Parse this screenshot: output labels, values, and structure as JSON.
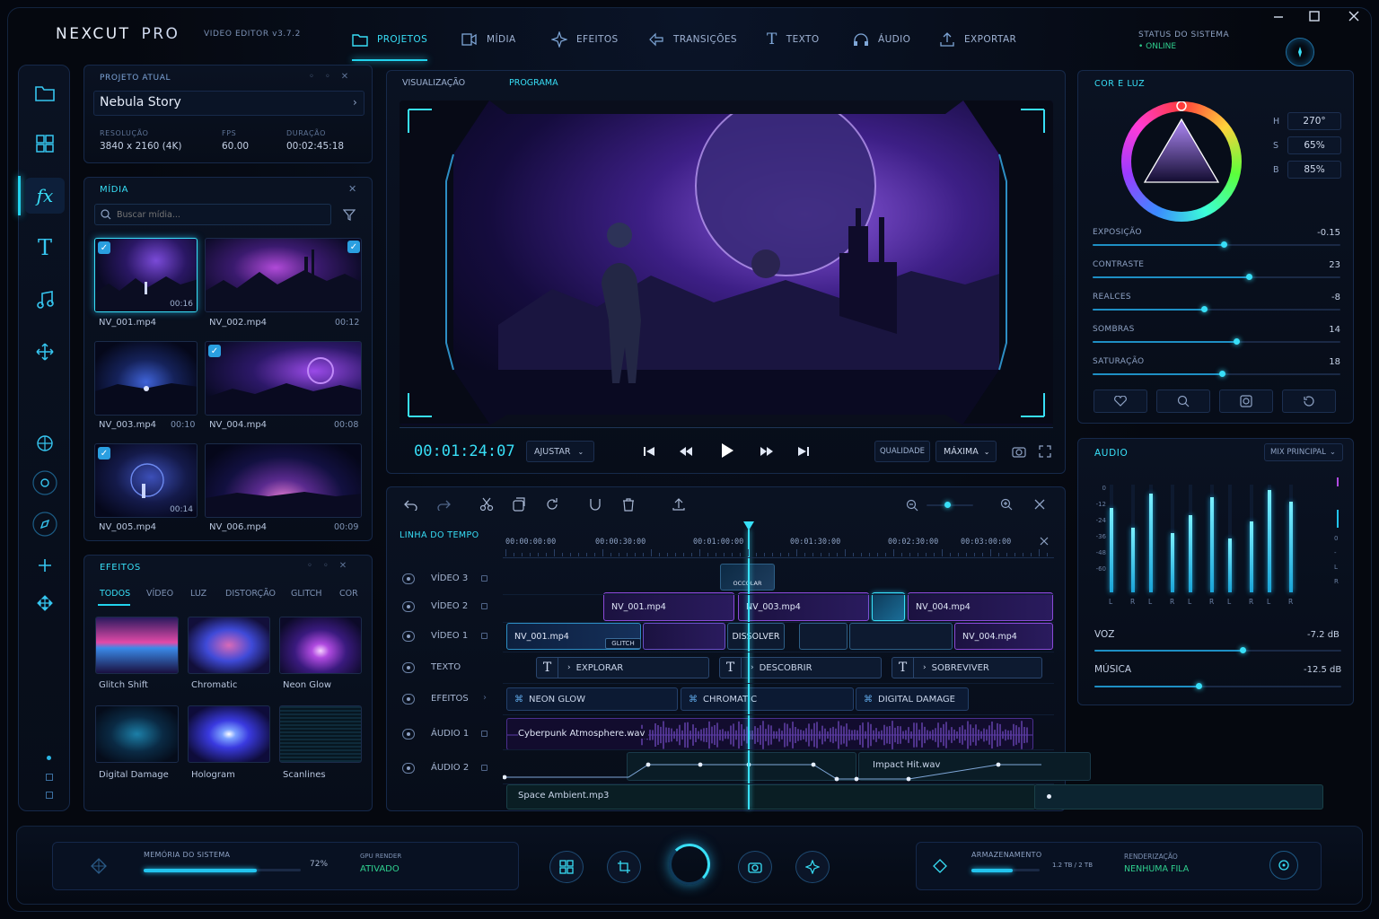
{
  "app": {
    "brand_a": "NEXCUT",
    "brand_b": "PRO",
    "version": "VIDEO EDITOR v3.7.2"
  },
  "nav": [
    {
      "label": "PROJETOS",
      "icon": "folder-icon"
    },
    {
      "label": "MÍDIA",
      "icon": "media-icon"
    },
    {
      "label": "EFEITOS",
      "icon": "sparkle-icon"
    },
    {
      "label": "TRANSIÇÕES",
      "icon": "transition-icon"
    },
    {
      "label": "TEXTO",
      "icon": "text-icon"
    },
    {
      "label": "ÁUDIO",
      "icon": "headphones-icon"
    },
    {
      "label": "EXPORTAR",
      "icon": "export-icon"
    }
  ],
  "status": {
    "title": "STATUS DO SISTEMA",
    "value": "• ONLINE"
  },
  "project": {
    "header": "PROJETO ATUAL",
    "name": "Nebula Story",
    "resolution_label": "RESOLUÇÃO",
    "resolution": "3840 x 2160 (4K)",
    "fps_label": "FPS",
    "fps": "60.00",
    "duration_label": "DURAÇÃO",
    "duration": "00:02:45:18"
  },
  "media": {
    "header": "MÍDIA",
    "search_placeholder": "Buscar mídia...",
    "items": [
      {
        "name": "NV_001.mp4",
        "dur": "00:16",
        "checked": true
      },
      {
        "name": "NV_002.mp4",
        "dur": "00:12",
        "checked": true
      },
      {
        "name": "NV_003.mp4",
        "dur": "00:10",
        "checked": false
      },
      {
        "name": "NV_004.mp4",
        "dur": "00:08",
        "checked": true
      },
      {
        "name": "NV_005.mp4",
        "dur": "00:14",
        "checked": true
      },
      {
        "name": "NV_006.mp4",
        "dur": "00:09",
        "checked": false
      }
    ]
  },
  "effects": {
    "header": "EFEITOS",
    "tabs": [
      "TODOS",
      "VÍDEO",
      "LUZ",
      "DISTORÇÃO",
      "GLITCH",
      "COR"
    ],
    "items": [
      "Glitch Shift",
      "Chromatic",
      "Neon Glow",
      "Digital Damage",
      "Hologram",
      "Scanlines"
    ]
  },
  "viewer": {
    "tabs": [
      "VISUALIZAÇÃO",
      "PROGRAMA"
    ],
    "timecode": "00:01:24:07",
    "fit": "AJUSTAR",
    "quality_label": "QUALIDADE",
    "quality": "MÁXIMA"
  },
  "color": {
    "header": "COR E LUZ",
    "h_label": "H",
    "h": "270°",
    "s_label": "S",
    "s": "65%",
    "b_label": "B",
    "b": "85%",
    "sliders": [
      {
        "label": "EXPOSIÇÃO",
        "value": "-0.15",
        "level": 0.53
      },
      {
        "label": "CONTRASTE",
        "value": "23",
        "level": 0.63
      },
      {
        "label": "REALCES",
        "value": "-8",
        "level": 0.45
      },
      {
        "label": "SOMBRAS",
        "value": "14",
        "level": 0.58
      },
      {
        "label": "SATURAÇÃO",
        "value": "18",
        "level": 0.52
      }
    ]
  },
  "audio": {
    "header": "AUDIO",
    "mix": "MIX PRINCIPAL",
    "scale": [
      "0",
      "-12",
      "-24",
      "-36",
      "-48",
      "-60"
    ],
    "right_scale": [
      "0",
      "-",
      "L",
      "R"
    ],
    "channels": [
      "L",
      "R",
      "L",
      "R",
      "L",
      "R",
      "L",
      "R",
      "L",
      "R"
    ],
    "levels": [
      0.78,
      0.6,
      0.92,
      0.55,
      0.72,
      0.88,
      0.5,
      0.66,
      0.95,
      0.84
    ],
    "voice_label": "VOZ",
    "voice": "-7.2 dB",
    "voice_level": 0.6,
    "music_label": "MÚSICA",
    "music": "-12.5 dB",
    "music_level": 0.42
  },
  "timeline": {
    "header": "LINHA DO TEMPO",
    "ticks": [
      "00:00:00:00",
      "00:00:30:00",
      "00:01:00:00",
      "00:01:30:00",
      "00:02:30:00",
      "00:03:00:00"
    ],
    "tracks": [
      "VÍDEO 3",
      "VÍDEO 2",
      "VÍDEO 1",
      "TEXTO",
      "EFEITOS",
      "ÁUDIO 1",
      "ÁUDIO 2"
    ],
    "v3_clip": "OCCOLAR",
    "v2": [
      "NV_001.mp4",
      "NV_003.mp4",
      "NV_004.mp4"
    ],
    "v1": [
      "NV_001.mp4",
      "GLITCH",
      "DISSOLVER",
      "NV_004.mp4"
    ],
    "texts": [
      "EXPLORAR",
      "DESCOBRIR",
      "SOBREVIVER"
    ],
    "fx": [
      "NEON GLOW",
      "CHROMATIC",
      "DIGITAL DAMAGE"
    ],
    "a1": "Cyberpunk Atmosphere.wav",
    "a2": "Impact Hit.wav",
    "a3": "Space Ambient.mp3"
  },
  "footer": {
    "mem_label": "MEMÓRIA DO SISTEMA",
    "mem": "72%",
    "mem_level": 0.72,
    "gpu_label": "GPU RENDER",
    "gpu": "ATIVADO",
    "storage_label": "ARMAZENAMENTO",
    "storage": "1.2 TB / 2 TB",
    "storage_level": 0.6,
    "render_label": "RENDERIZAÇÃO",
    "render": "NENHUMA FILA"
  }
}
